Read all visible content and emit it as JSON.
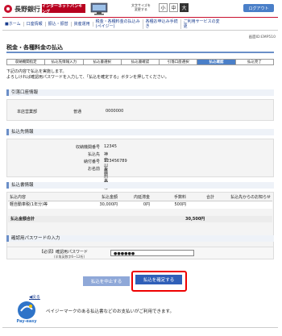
{
  "header": {
    "bank_name": "長野銀行",
    "ibank": "インターネットバンキング",
    "text_size_label": "文字サイズを\n変更する",
    "sizes": [
      "小",
      "中",
      "大"
    ],
    "logout": "ログアウト"
  },
  "nav": {
    "items": [
      "ホーム",
      "口座情報",
      "振込・振替",
      "資産運用",
      "税金・各種料金の払込み(ペイジー)",
      "各種お申込み手続き",
      "ご利用サービスの変更"
    ]
  },
  "screen_id": "画面ID:EMP510",
  "page_title": "税金・各種料金の払込",
  "steps": [
    "収納機関指定",
    "払込先情報入力",
    "払込書選択",
    "払込書確認",
    "引落口座選択",
    "払込確認",
    "払込完了"
  ],
  "current_step": 5,
  "instructions": [
    "下記の内容で払込を実施します。",
    "よろしければ確認用パスワードを入力して、「払込を確定する」ボタンを押してください。"
  ],
  "account": {
    "heading": "引落口座情報",
    "branch": "本店営業部",
    "type": "普通",
    "number": "0000000"
  },
  "payee": {
    "heading": "払込先情報",
    "rows": [
      {
        "label": "収納機関番号",
        "value": "12345"
      },
      {
        "label": "払込先",
        "value": "神奈川県川崎市"
      },
      {
        "label": "納付番号",
        "value": "123456789"
      },
      {
        "label": "お名前",
        "value": "長野 太郎"
      }
    ]
  },
  "bill": {
    "heading": "払込書情報",
    "columns": [
      "払込内容",
      "払込金額",
      "内延滞金",
      "手数料",
      "合計",
      "払込先からのお知らせ"
    ],
    "row": [
      "軽自動車税(1年分)等",
      "30,000円",
      "0円",
      "500円",
      "",
      ""
    ],
    "total_label": "払込金額合計",
    "total_value": "30,500円"
  },
  "password": {
    "heading": "確認用パスワードの入力",
    "label": "【必須】確認用パスワード",
    "note": "(半角英数字6~12桁)",
    "value": "●●●●●●"
  },
  "buttons": {
    "cancel": "払込を中止する",
    "confirm": "払込を確定する",
    "back": "戻る"
  },
  "payeasy": {
    "logo": "Pay-easy",
    "note": "ペイジーマークのある払込書などのお支払いがご利用できます。"
  },
  "colors": {
    "brand": "#c8102e",
    "accent": "#2f5fb8",
    "highlight": "#e00000"
  }
}
